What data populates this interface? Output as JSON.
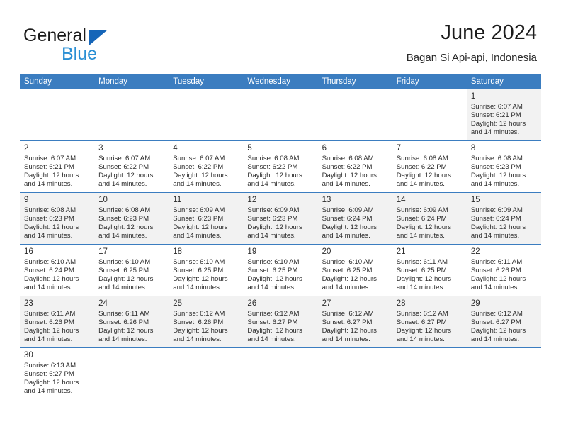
{
  "brand": {
    "name_part1": "General",
    "name_part2": "Blue",
    "triangle_icon": "triangle-icon",
    "accent_color": "#1565b8",
    "secondary_color": "#2a8fd4"
  },
  "header": {
    "title": "June 2024",
    "subtitle": "Bagan Si Api-api, Indonesia"
  },
  "calendar": {
    "header_bg_color": "#3b7dc0",
    "row_shade_color": "#f2f2f2",
    "weekdays": [
      "Sunday",
      "Monday",
      "Tuesday",
      "Wednesday",
      "Thursday",
      "Friday",
      "Saturday"
    ],
    "labels": {
      "sunrise": "Sunrise:",
      "sunset": "Sunset:",
      "daylight": "Daylight:"
    },
    "weeks": [
      [
        {
          "day": "",
          "sunrise": "",
          "sunset": "",
          "daylight_line1": "",
          "daylight_line2": ""
        },
        {
          "day": "",
          "sunrise": "",
          "sunset": "",
          "daylight_line1": "",
          "daylight_line2": ""
        },
        {
          "day": "",
          "sunrise": "",
          "sunset": "",
          "daylight_line1": "",
          "daylight_line2": ""
        },
        {
          "day": "",
          "sunrise": "",
          "sunset": "",
          "daylight_line1": "",
          "daylight_line2": ""
        },
        {
          "day": "",
          "sunrise": "",
          "sunset": "",
          "daylight_line1": "",
          "daylight_line2": ""
        },
        {
          "day": "",
          "sunrise": "",
          "sunset": "",
          "daylight_line1": "",
          "daylight_line2": ""
        },
        {
          "day": "1",
          "sunrise": "Sunrise: 6:07 AM",
          "sunset": "Sunset: 6:21 PM",
          "daylight_line1": "Daylight: 12 hours",
          "daylight_line2": "and 14 minutes."
        }
      ],
      [
        {
          "day": "2",
          "sunrise": "Sunrise: 6:07 AM",
          "sunset": "Sunset: 6:21 PM",
          "daylight_line1": "Daylight: 12 hours",
          "daylight_line2": "and 14 minutes."
        },
        {
          "day": "3",
          "sunrise": "Sunrise: 6:07 AM",
          "sunset": "Sunset: 6:22 PM",
          "daylight_line1": "Daylight: 12 hours",
          "daylight_line2": "and 14 minutes."
        },
        {
          "day": "4",
          "sunrise": "Sunrise: 6:07 AM",
          "sunset": "Sunset: 6:22 PM",
          "daylight_line1": "Daylight: 12 hours",
          "daylight_line2": "and 14 minutes."
        },
        {
          "day": "5",
          "sunrise": "Sunrise: 6:08 AM",
          "sunset": "Sunset: 6:22 PM",
          "daylight_line1": "Daylight: 12 hours",
          "daylight_line2": "and 14 minutes."
        },
        {
          "day": "6",
          "sunrise": "Sunrise: 6:08 AM",
          "sunset": "Sunset: 6:22 PM",
          "daylight_line1": "Daylight: 12 hours",
          "daylight_line2": "and 14 minutes."
        },
        {
          "day": "7",
          "sunrise": "Sunrise: 6:08 AM",
          "sunset": "Sunset: 6:22 PM",
          "daylight_line1": "Daylight: 12 hours",
          "daylight_line2": "and 14 minutes."
        },
        {
          "day": "8",
          "sunrise": "Sunrise: 6:08 AM",
          "sunset": "Sunset: 6:23 PM",
          "daylight_line1": "Daylight: 12 hours",
          "daylight_line2": "and 14 minutes."
        }
      ],
      [
        {
          "day": "9",
          "sunrise": "Sunrise: 6:08 AM",
          "sunset": "Sunset: 6:23 PM",
          "daylight_line1": "Daylight: 12 hours",
          "daylight_line2": "and 14 minutes."
        },
        {
          "day": "10",
          "sunrise": "Sunrise: 6:08 AM",
          "sunset": "Sunset: 6:23 PM",
          "daylight_line1": "Daylight: 12 hours",
          "daylight_line2": "and 14 minutes."
        },
        {
          "day": "11",
          "sunrise": "Sunrise: 6:09 AM",
          "sunset": "Sunset: 6:23 PM",
          "daylight_line1": "Daylight: 12 hours",
          "daylight_line2": "and 14 minutes."
        },
        {
          "day": "12",
          "sunrise": "Sunrise: 6:09 AM",
          "sunset": "Sunset: 6:23 PM",
          "daylight_line1": "Daylight: 12 hours",
          "daylight_line2": "and 14 minutes."
        },
        {
          "day": "13",
          "sunrise": "Sunrise: 6:09 AM",
          "sunset": "Sunset: 6:24 PM",
          "daylight_line1": "Daylight: 12 hours",
          "daylight_line2": "and 14 minutes."
        },
        {
          "day": "14",
          "sunrise": "Sunrise: 6:09 AM",
          "sunset": "Sunset: 6:24 PM",
          "daylight_line1": "Daylight: 12 hours",
          "daylight_line2": "and 14 minutes."
        },
        {
          "day": "15",
          "sunrise": "Sunrise: 6:09 AM",
          "sunset": "Sunset: 6:24 PM",
          "daylight_line1": "Daylight: 12 hours",
          "daylight_line2": "and 14 minutes."
        }
      ],
      [
        {
          "day": "16",
          "sunrise": "Sunrise: 6:10 AM",
          "sunset": "Sunset: 6:24 PM",
          "daylight_line1": "Daylight: 12 hours",
          "daylight_line2": "and 14 minutes."
        },
        {
          "day": "17",
          "sunrise": "Sunrise: 6:10 AM",
          "sunset": "Sunset: 6:25 PM",
          "daylight_line1": "Daylight: 12 hours",
          "daylight_line2": "and 14 minutes."
        },
        {
          "day": "18",
          "sunrise": "Sunrise: 6:10 AM",
          "sunset": "Sunset: 6:25 PM",
          "daylight_line1": "Daylight: 12 hours",
          "daylight_line2": "and 14 minutes."
        },
        {
          "day": "19",
          "sunrise": "Sunrise: 6:10 AM",
          "sunset": "Sunset: 6:25 PM",
          "daylight_line1": "Daylight: 12 hours",
          "daylight_line2": "and 14 minutes."
        },
        {
          "day": "20",
          "sunrise": "Sunrise: 6:10 AM",
          "sunset": "Sunset: 6:25 PM",
          "daylight_line1": "Daylight: 12 hours",
          "daylight_line2": "and 14 minutes."
        },
        {
          "day": "21",
          "sunrise": "Sunrise: 6:11 AM",
          "sunset": "Sunset: 6:25 PM",
          "daylight_line1": "Daylight: 12 hours",
          "daylight_line2": "and 14 minutes."
        },
        {
          "day": "22",
          "sunrise": "Sunrise: 6:11 AM",
          "sunset": "Sunset: 6:26 PM",
          "daylight_line1": "Daylight: 12 hours",
          "daylight_line2": "and 14 minutes."
        }
      ],
      [
        {
          "day": "23",
          "sunrise": "Sunrise: 6:11 AM",
          "sunset": "Sunset: 6:26 PM",
          "daylight_line1": "Daylight: 12 hours",
          "daylight_line2": "and 14 minutes."
        },
        {
          "day": "24",
          "sunrise": "Sunrise: 6:11 AM",
          "sunset": "Sunset: 6:26 PM",
          "daylight_line1": "Daylight: 12 hours",
          "daylight_line2": "and 14 minutes."
        },
        {
          "day": "25",
          "sunrise": "Sunrise: 6:12 AM",
          "sunset": "Sunset: 6:26 PM",
          "daylight_line1": "Daylight: 12 hours",
          "daylight_line2": "and 14 minutes."
        },
        {
          "day": "26",
          "sunrise": "Sunrise: 6:12 AM",
          "sunset": "Sunset: 6:27 PM",
          "daylight_line1": "Daylight: 12 hours",
          "daylight_line2": "and 14 minutes."
        },
        {
          "day": "27",
          "sunrise": "Sunrise: 6:12 AM",
          "sunset": "Sunset: 6:27 PM",
          "daylight_line1": "Daylight: 12 hours",
          "daylight_line2": "and 14 minutes."
        },
        {
          "day": "28",
          "sunrise": "Sunrise: 6:12 AM",
          "sunset": "Sunset: 6:27 PM",
          "daylight_line1": "Daylight: 12 hours",
          "daylight_line2": "and 14 minutes."
        },
        {
          "day": "29",
          "sunrise": "Sunrise: 6:12 AM",
          "sunset": "Sunset: 6:27 PM",
          "daylight_line1": "Daylight: 12 hours",
          "daylight_line2": "and 14 minutes."
        }
      ],
      [
        {
          "day": "30",
          "sunrise": "Sunrise: 6:13 AM",
          "sunset": "Sunset: 6:27 PM",
          "daylight_line1": "Daylight: 12 hours",
          "daylight_line2": "and 14 minutes."
        },
        {
          "day": "",
          "sunrise": "",
          "sunset": "",
          "daylight_line1": "",
          "daylight_line2": ""
        },
        {
          "day": "",
          "sunrise": "",
          "sunset": "",
          "daylight_line1": "",
          "daylight_line2": ""
        },
        {
          "day": "",
          "sunrise": "",
          "sunset": "",
          "daylight_line1": "",
          "daylight_line2": ""
        },
        {
          "day": "",
          "sunrise": "",
          "sunset": "",
          "daylight_line1": "",
          "daylight_line2": ""
        },
        {
          "day": "",
          "sunrise": "",
          "sunset": "",
          "daylight_line1": "",
          "daylight_line2": ""
        },
        {
          "day": "",
          "sunrise": "",
          "sunset": "",
          "daylight_line1": "",
          "daylight_line2": ""
        }
      ]
    ]
  }
}
